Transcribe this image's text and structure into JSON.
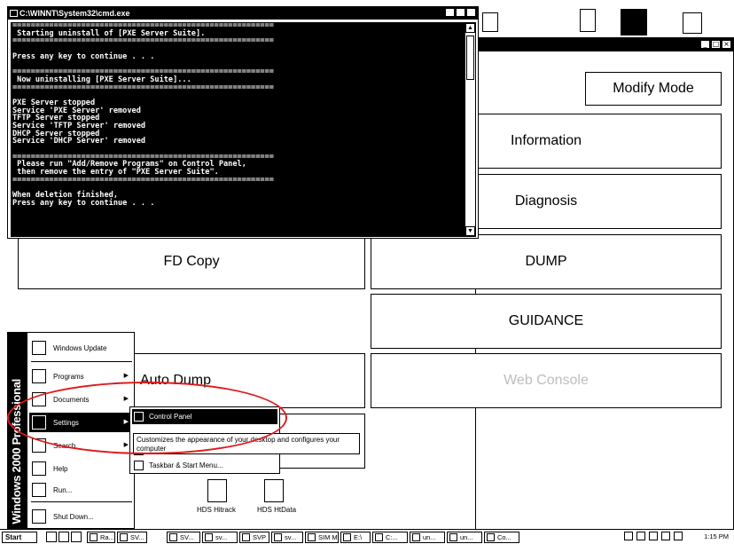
{
  "cmd_window": {
    "title": "C:\\WINNT\\System32\\cmd.exe",
    "lines": [
      "=========================================================",
      " Starting uninstall of [PXE Server Suite].",
      "=========================================================",
      "",
      "Press any key to continue . . .",
      "",
      "=========================================================",
      " Now uninstalling [PXE Server Suite]...",
      "=========================================================",
      "",
      "PXE Server stopped",
      "Service 'PXE Server' removed",
      "TFTP Server stopped",
      "Service 'TFTP Server' removed",
      "DHCP Server stopped",
      "Service 'DHCP Server' removed",
      "",
      "=========================================================",
      " Please run \"Add/Remove Programs\" on Control Panel,",
      " then remove the entry of \"PXE Server Suite\".",
      "=========================================================",
      "",
      "When deletion finished,",
      "Press any key to continue . . ."
    ]
  },
  "svp_window": {
    "buttons": {
      "modify_mode": "Modify Mode",
      "information": "Information",
      "diagnosis": "Diagnosis",
      "fd_copy": "FD Copy",
      "dump": "DUMP",
      "guidance": "GUIDANCE",
      "auto_dump": "Auto Dump",
      "web_console": "Web Console"
    }
  },
  "desktop_icons": {
    "hds_hitrack": "HDS Hitrack",
    "hds_htdata": "HDS HtData"
  },
  "start_menu": {
    "band_text": "Windows 2000 Professional",
    "items": {
      "windows_update": "Windows Update",
      "programs": "Programs",
      "documents": "Documents",
      "settings": "Settings",
      "search": "Search",
      "help": "Help",
      "run": "Run...",
      "shut_down": "Shut Down..."
    }
  },
  "settings_submenu": {
    "control_panel": "Control Panel",
    "taskbar": "Taskbar & Start Menu..."
  },
  "tooltip": "Customizes the appearance of your desktop and configures your computer",
  "taskbar": {
    "start": "Start",
    "tasks": [
      "Ra...",
      "SV...",
      "SV...",
      "sv...",
      "SVP",
      "sv...",
      "SIM M...",
      "E:\\",
      "C:...",
      "un...",
      "un...",
      "Co..."
    ],
    "clock": "1:15 PM"
  }
}
